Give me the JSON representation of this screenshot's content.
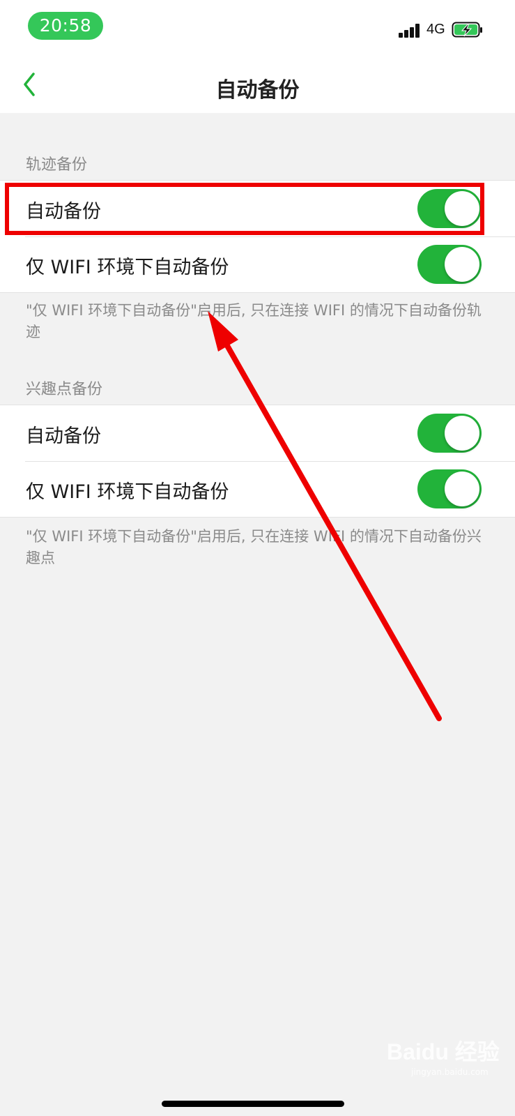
{
  "status_bar": {
    "time": "20:58",
    "network": "4G",
    "icons": [
      "signal-icon",
      "battery-charging-icon"
    ]
  },
  "nav": {
    "title": "自动备份",
    "back_icon": "chevron-left-icon",
    "accent_color": "#22b33a"
  },
  "track_section": {
    "header": "轨迹备份",
    "items": [
      {
        "label": "自动备份",
        "enabled": true
      },
      {
        "label": "仅 WIFI 环境下自动备份",
        "enabled": true
      }
    ],
    "note": "\"仅 WIFI 环境下自动备份\"启用后, 只在连接 WIFI 的情况下自动备份轨迹"
  },
  "poi_section": {
    "header": "兴趣点备份",
    "items": [
      {
        "label": "自动备份",
        "enabled": true
      },
      {
        "label": "仅 WIFI 环境下自动备份",
        "enabled": true
      }
    ],
    "note": "\"仅 WIFI 环境下自动备份\"启用后, 只在连接 WIFI 的情况下自动备份兴趣点"
  },
  "annotation_color": "#ee0000",
  "watermark": {
    "text": "Baidu 经验",
    "url": "jingyan.baidu.com"
  }
}
